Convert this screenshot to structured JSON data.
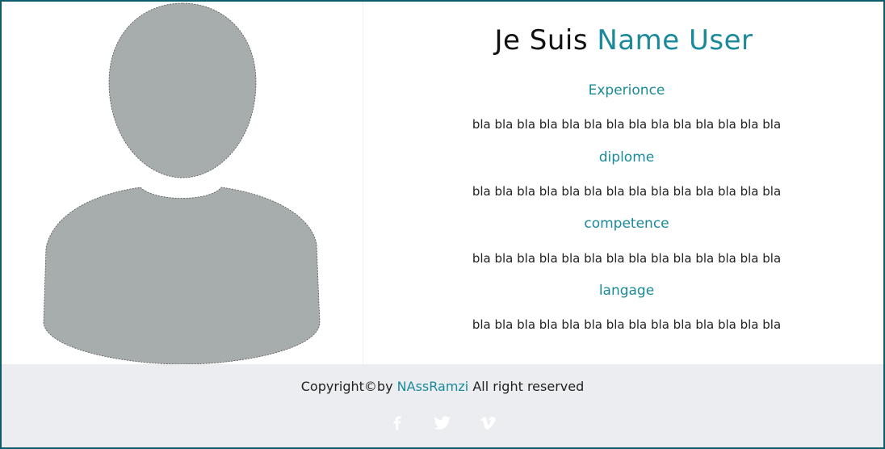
{
  "header": {
    "title_prefix": "Je Suis",
    "title_name": "Name User"
  },
  "sections": [
    {
      "heading": "Experionce",
      "text": "bla bla bla bla bla bla bla bla bla bla bla bla bla bla"
    },
    {
      "heading": "diplome",
      "text": "bla bla bla bla bla bla bla bla bla bla bla bla bla bla"
    },
    {
      "heading": "competence",
      "text": "bla bla bla bla bla bla bla bla bla bla bla bla bla bla"
    },
    {
      "heading": "langage",
      "text": "bla bla bla bla bla bla bla bla bla bla bla bla bla bla"
    }
  ],
  "footer": {
    "copyright_prefix": "Copyright©by",
    "author": "NAssRamzi",
    "copyright_suffix": "All right reserved",
    "social_icons": [
      "facebook-icon",
      "twitter-icon",
      "vimeo-icon"
    ]
  },
  "colors": {
    "accent": "#1a8a9a",
    "avatar": "#a7acad",
    "footer_bg": "#ebedf0",
    "frame": "#0b5d6b"
  }
}
